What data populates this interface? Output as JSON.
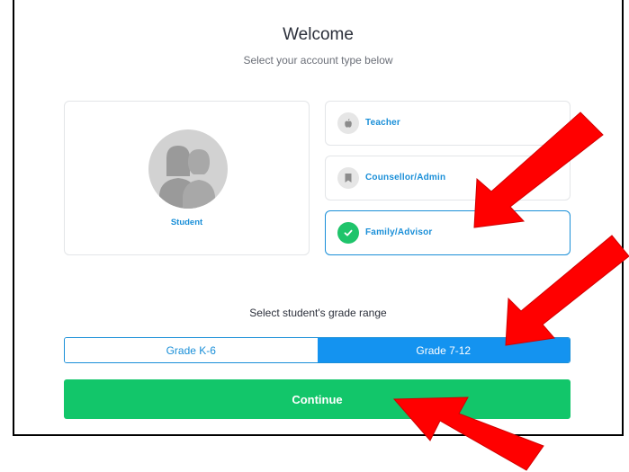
{
  "header": {
    "title": "Welcome",
    "subtitle": "Select your account type below"
  },
  "account_types": {
    "student": {
      "label": "Student",
      "icon": "students-avatar-icon"
    },
    "options": [
      {
        "label": "Teacher",
        "icon": "apple-icon",
        "selected": false
      },
      {
        "label": "Counsellor/Admin",
        "icon": "bookmark-icon",
        "selected": false
      },
      {
        "label": "Family/Advisor",
        "icon": "checkmark-icon",
        "selected": true
      }
    ]
  },
  "grade_range": {
    "heading": "Select student's grade range",
    "options": [
      {
        "label": "Grade K-6",
        "selected": false
      },
      {
        "label": "Grade 7-12",
        "selected": true
      }
    ]
  },
  "actions": {
    "continue_label": "Continue"
  },
  "colors": {
    "accent_blue": "#1493f0",
    "continue_green": "#12c66a",
    "check_green": "#1fc46b",
    "annotation_arrow": "#ff0000"
  }
}
